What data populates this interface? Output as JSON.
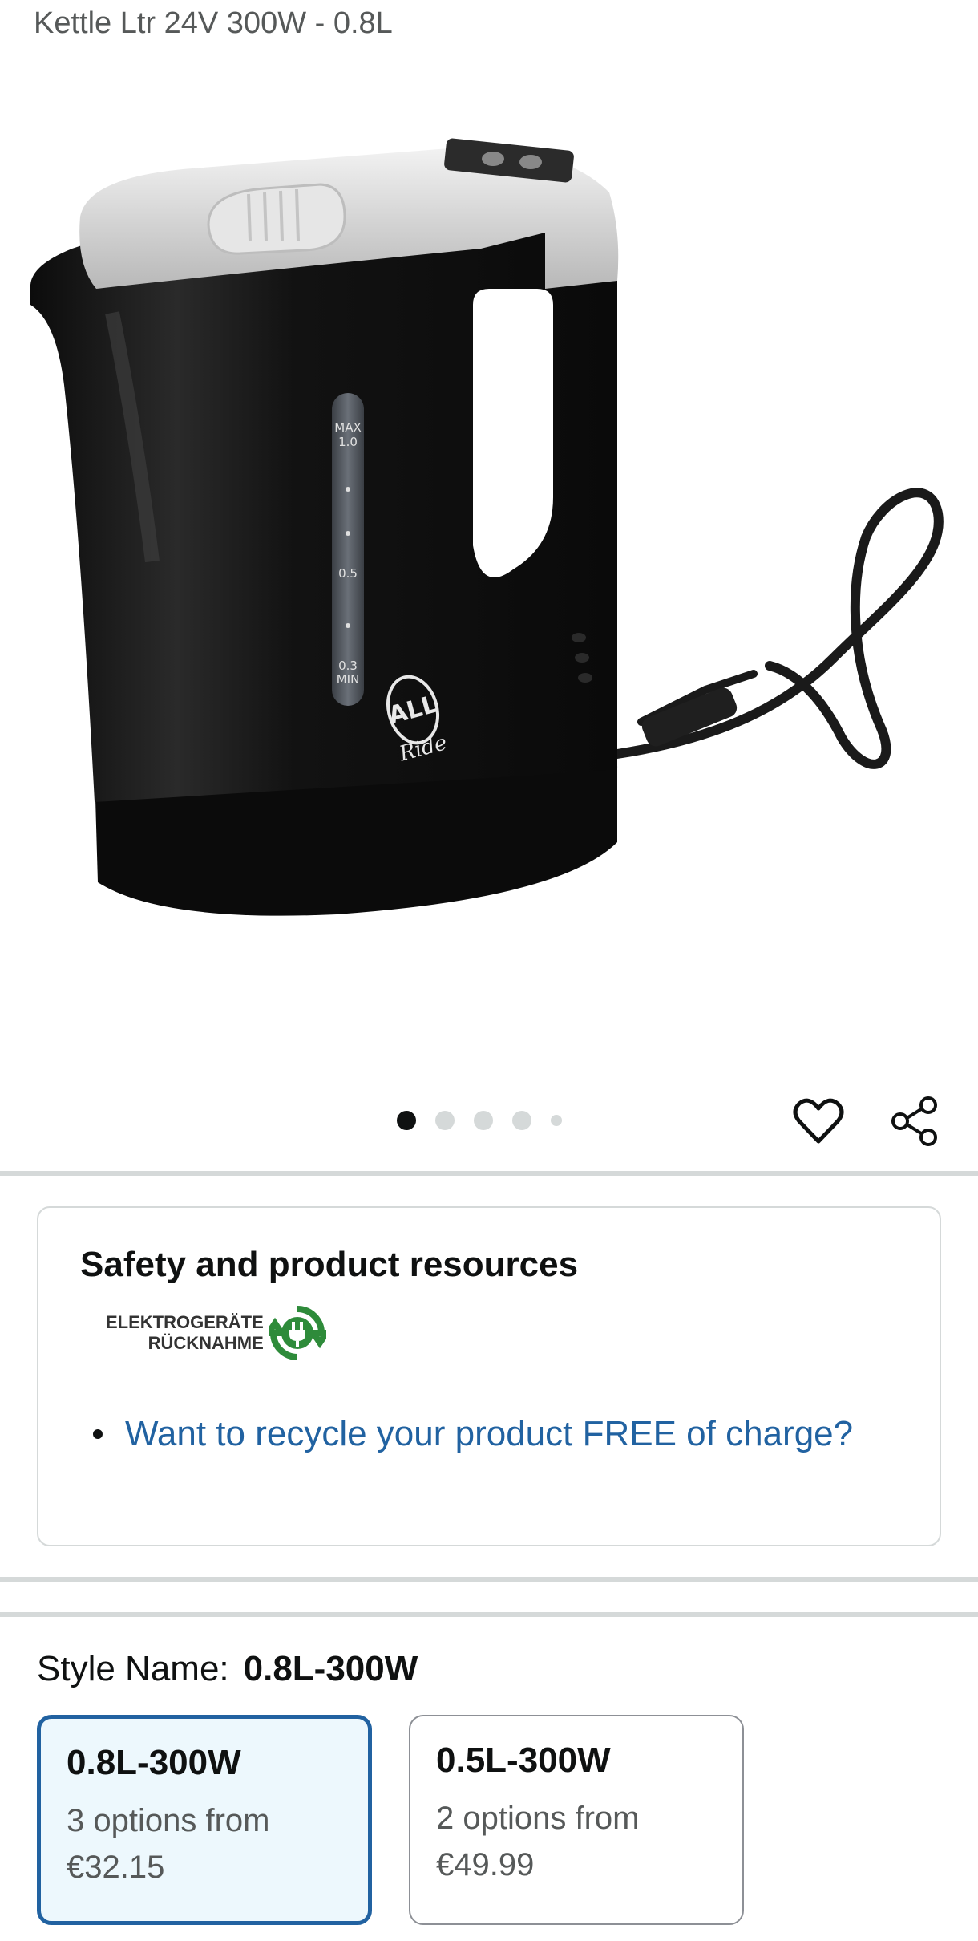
{
  "product": {
    "title": "Kettle Ltr 24V 300W - 0.8L"
  },
  "image": {
    "kettle_scale_labels": [
      "MAX",
      "1.0",
      "0.5",
      "0.3",
      "MIN"
    ],
    "brand_logo_text": "ALL Ride"
  },
  "carousel": {
    "dots": [
      "active",
      "normal",
      "normal",
      "normal",
      "small"
    ]
  },
  "actions": {
    "wishlist_icon": "heart-icon",
    "share_icon": "share-icon"
  },
  "safety": {
    "heading": "Safety and product resources",
    "logo_line1": "ELEKTROGERÄTE",
    "logo_line2": "RÜCKNAHME",
    "recycle_link": "Want to recycle your product FREE of charge?"
  },
  "style": {
    "label": "Style Name:",
    "selected_value": "0.8L-300W",
    "options": [
      {
        "name": "0.8L-300W",
        "line1": "3 options from",
        "line2": "€32.15",
        "selected": true
      },
      {
        "name": "0.5L-300W",
        "line1": "2 options from",
        "line2": "€49.99",
        "selected": false
      }
    ]
  },
  "colors": {
    "link": "#2162a1",
    "selected_border": "#2162a1",
    "selected_bg": "#edf8fd",
    "recycle_green": "#2e8b3a",
    "divider": "#d5d9d9"
  }
}
